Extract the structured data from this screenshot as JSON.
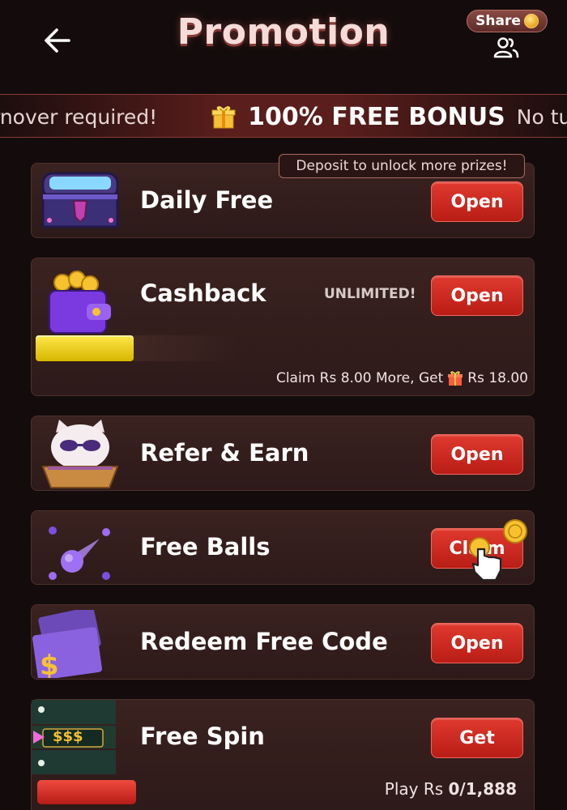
{
  "header": {
    "title": "Promotion",
    "share_label": "Share"
  },
  "marquee": {
    "text_before": "rnover required!",
    "bonus_text": "100% FREE BONUS",
    "text_after": "No tur"
  },
  "cards": {
    "daily_free": {
      "title": "Daily Free",
      "button": "Open",
      "tooltip": "Deposit to unlock more prizes!"
    },
    "cashback": {
      "title": "Cashback",
      "badge": "UNLIMITED!",
      "button": "Open",
      "note_before": "Claim Rs 8.00 More, Get",
      "note_after": "Rs 18.00"
    },
    "refer_earn": {
      "title": "Refer & Earn",
      "button": "Open"
    },
    "free_balls": {
      "title": "Free Balls",
      "button": "Claim"
    },
    "redeem_code": {
      "title": "Redeem Free Code",
      "button": "Open"
    },
    "free_spin": {
      "title": "Free Spin",
      "button": "Get",
      "icon_text": "$$$",
      "play_label": "Play Rs ",
      "play_value": "0/1,888"
    }
  },
  "colors": {
    "background": "#140c0c",
    "card": "#35201f",
    "button_red": "#d02a22",
    "accent_gold": "#f2c230"
  },
  "icons": {
    "back": "arrow-left-icon",
    "share": "coin-icon",
    "share_user": "users-icon",
    "gift": "gift-icon",
    "daily_free": "treasure-chest-icon",
    "cashback": "wallet-coins-icon",
    "refer": "cat-icon",
    "balls": "comet-ball-icon",
    "redeem": "ticket-dollar-icon",
    "spin": "slot-icon",
    "pointer": "hand-pointer-icon"
  }
}
